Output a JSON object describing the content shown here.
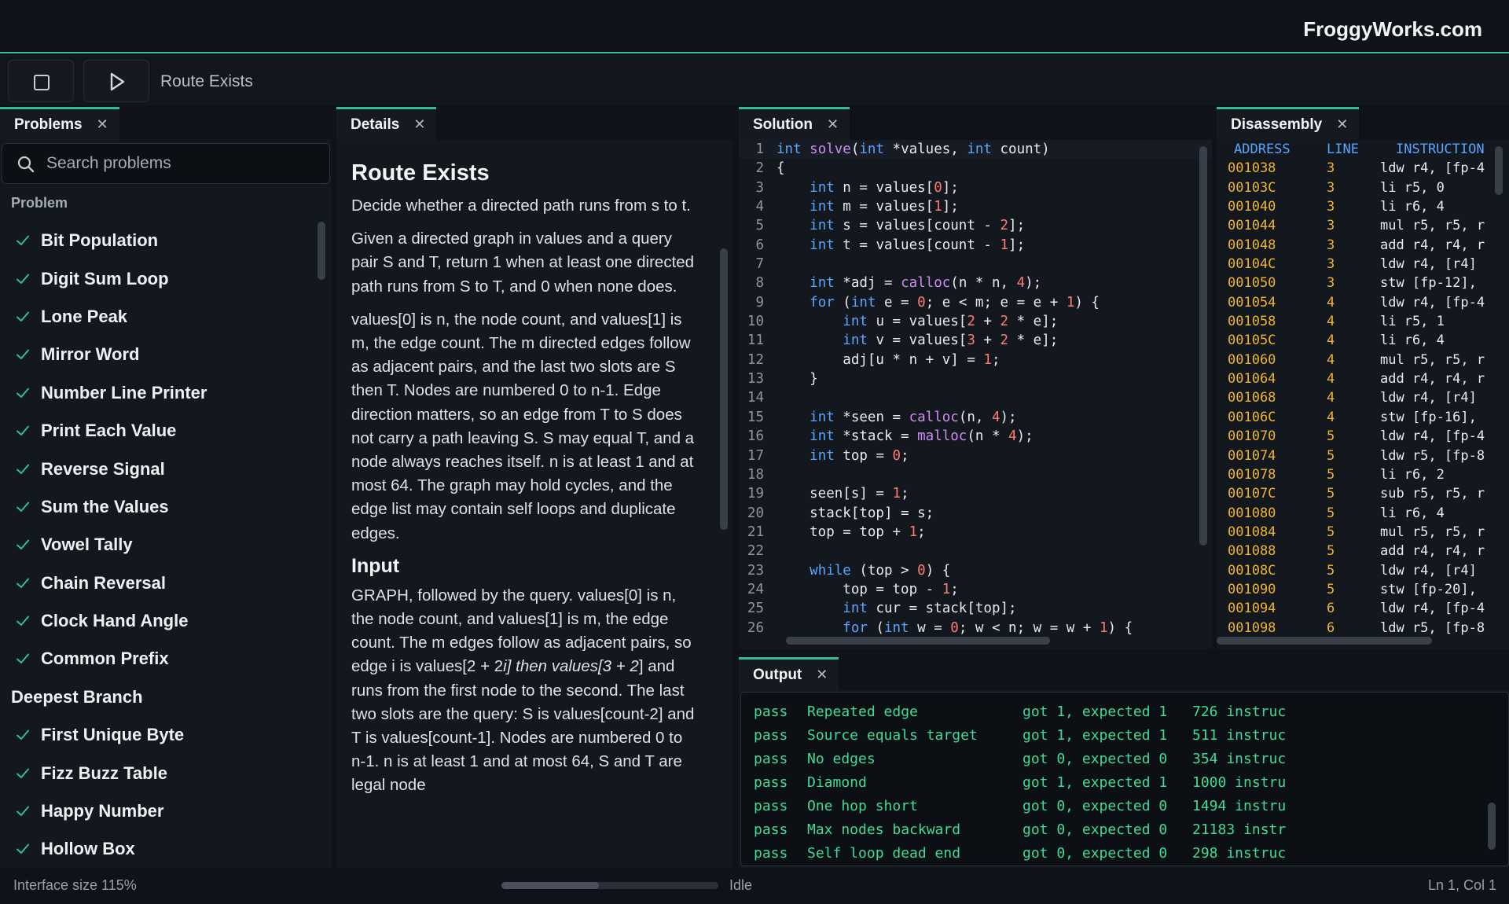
{
  "brand": "FroggyWorks.com",
  "toolbar": {
    "title": "Route Exists"
  },
  "problems": {
    "tab_label": "Problems",
    "search_placeholder": "Search problems",
    "header": "Problem",
    "items": [
      {
        "name": "Bit Population",
        "solved": true
      },
      {
        "name": "Digit Sum Loop",
        "solved": true
      },
      {
        "name": "Lone Peak",
        "solved": true
      },
      {
        "name": "Mirror Word",
        "solved": true
      },
      {
        "name": "Number Line Printer",
        "solved": true
      },
      {
        "name": "Print Each Value",
        "solved": true
      },
      {
        "name": "Reverse Signal",
        "solved": true
      },
      {
        "name": "Sum the Values",
        "solved": true
      },
      {
        "name": "Vowel Tally",
        "solved": true
      },
      {
        "name": "Chain Reversal",
        "solved": true
      },
      {
        "name": "Clock Hand Angle",
        "solved": true
      },
      {
        "name": "Common Prefix",
        "solved": true
      },
      {
        "name": "Deepest Branch",
        "solved": false
      },
      {
        "name": "First Unique Byte",
        "solved": true
      },
      {
        "name": "Fizz Buzz Table",
        "solved": true
      },
      {
        "name": "Happy Number",
        "solved": true
      },
      {
        "name": "Hollow Box",
        "solved": true
      }
    ]
  },
  "details": {
    "tab_label": "Details",
    "title": "Route Exists",
    "paragraphs": [
      "Decide whether a directed path runs from s to t.",
      "Given a directed graph in values and a query pair S and T, return 1 when at least one directed path runs from S to T, and 0 when none does.",
      "values[0] is n, the node count, and values[1] is m, the edge count. The m directed edges follow as adjacent pairs, and the last two slots are S then T. Nodes are numbered 0 to n-1. Edge direction matters, so an edge from T to S does not carry a path leaving S. S may equal T, and a node always reaches itself. n is at least 1 and at most 64. The graph may hold cycles, and the edge list may contain self loops and duplicate edges."
    ],
    "input_heading": "Input",
    "input_paragraph_a": "GRAPH, followed by the query. values[0] is n, the node count, and values[1] is m, the edge count. The m edges follow as adjacent pairs, so edge i is values[2 + 2",
    "input_paragraph_italic": "i] then values[3 + 2",
    "input_paragraph_b": "] and runs from the first node to the second. The last two slots are the query: S is values[count-2] and T is values[count-1]. Nodes are numbered 0 to n-1. n is at least 1 and at most 64, S and T are legal node"
  },
  "solution": {
    "tab_label": "Solution",
    "lines": [
      {
        "n": "1",
        "segs": [
          [
            "kw",
            "int"
          ],
          [
            "t",
            " "
          ],
          [
            "fn",
            "solve"
          ],
          [
            "t",
            "("
          ],
          [
            "kw",
            "int"
          ],
          [
            "t",
            " *values, "
          ],
          [
            "kw",
            "int"
          ],
          [
            "t",
            " count)"
          ]
        ]
      },
      {
        "n": "2",
        "segs": [
          [
            "t",
            "{"
          ]
        ]
      },
      {
        "n": "3",
        "segs": [
          [
            "t",
            "    "
          ],
          [
            "kw",
            "int"
          ],
          [
            "t",
            " n = values["
          ],
          [
            "nu",
            "0"
          ],
          [
            "t",
            "];"
          ]
        ]
      },
      {
        "n": "4",
        "segs": [
          [
            "t",
            "    "
          ],
          [
            "kw",
            "int"
          ],
          [
            "t",
            " m = values["
          ],
          [
            "nu",
            "1"
          ],
          [
            "t",
            "];"
          ]
        ]
      },
      {
        "n": "5",
        "segs": [
          [
            "t",
            "    "
          ],
          [
            "kw",
            "int"
          ],
          [
            "t",
            " s = values[count - "
          ],
          [
            "nu",
            "2"
          ],
          [
            "t",
            "];"
          ]
        ]
      },
      {
        "n": "6",
        "segs": [
          [
            "t",
            "    "
          ],
          [
            "kw",
            "int"
          ],
          [
            "t",
            " t = values[count - "
          ],
          [
            "nu",
            "1"
          ],
          [
            "t",
            "];"
          ]
        ]
      },
      {
        "n": "7",
        "segs": [
          [
            "t",
            ""
          ]
        ]
      },
      {
        "n": "8",
        "segs": [
          [
            "t",
            "    "
          ],
          [
            "kw",
            "int"
          ],
          [
            "t",
            " *adj = "
          ],
          [
            "fn",
            "calloc"
          ],
          [
            "t",
            "(n * n, "
          ],
          [
            "nu",
            "4"
          ],
          [
            "t",
            ");"
          ]
        ]
      },
      {
        "n": "9",
        "segs": [
          [
            "t",
            "    "
          ],
          [
            "kw",
            "for"
          ],
          [
            "t",
            " ("
          ],
          [
            "kw",
            "int"
          ],
          [
            "t",
            " e = "
          ],
          [
            "nu",
            "0"
          ],
          [
            "t",
            "; e < m; e = e + "
          ],
          [
            "nu",
            "1"
          ],
          [
            "t",
            ") {"
          ]
        ]
      },
      {
        "n": "10",
        "segs": [
          [
            "t",
            "        "
          ],
          [
            "kw",
            "int"
          ],
          [
            "t",
            " u = values["
          ],
          [
            "nu",
            "2"
          ],
          [
            "t",
            " + "
          ],
          [
            "nu",
            "2"
          ],
          [
            "t",
            " * e];"
          ]
        ]
      },
      {
        "n": "11",
        "segs": [
          [
            "t",
            "        "
          ],
          [
            "kw",
            "int"
          ],
          [
            "t",
            " v = values["
          ],
          [
            "nu",
            "3"
          ],
          [
            "t",
            " + "
          ],
          [
            "nu",
            "2"
          ],
          [
            "t",
            " * e];"
          ]
        ]
      },
      {
        "n": "12",
        "segs": [
          [
            "t",
            "        adj[u * n + v] = "
          ],
          [
            "nu",
            "1"
          ],
          [
            "t",
            ";"
          ]
        ]
      },
      {
        "n": "13",
        "segs": [
          [
            "t",
            "    }"
          ]
        ]
      },
      {
        "n": "14",
        "segs": [
          [
            "t",
            ""
          ]
        ]
      },
      {
        "n": "15",
        "segs": [
          [
            "t",
            "    "
          ],
          [
            "kw",
            "int"
          ],
          [
            "t",
            " *seen = "
          ],
          [
            "fn",
            "calloc"
          ],
          [
            "t",
            "(n, "
          ],
          [
            "nu",
            "4"
          ],
          [
            "t",
            ");"
          ]
        ]
      },
      {
        "n": "16",
        "segs": [
          [
            "t",
            "    "
          ],
          [
            "kw",
            "int"
          ],
          [
            "t",
            " *stack = "
          ],
          [
            "fn",
            "malloc"
          ],
          [
            "t",
            "(n * "
          ],
          [
            "nu",
            "4"
          ],
          [
            "t",
            ");"
          ]
        ]
      },
      {
        "n": "17",
        "segs": [
          [
            "t",
            "    "
          ],
          [
            "kw",
            "int"
          ],
          [
            "t",
            " top = "
          ],
          [
            "nu",
            "0"
          ],
          [
            "t",
            ";"
          ]
        ]
      },
      {
        "n": "18",
        "segs": [
          [
            "t",
            ""
          ]
        ]
      },
      {
        "n": "19",
        "segs": [
          [
            "t",
            "    seen[s] = "
          ],
          [
            "nu",
            "1"
          ],
          [
            "t",
            ";"
          ]
        ]
      },
      {
        "n": "20",
        "segs": [
          [
            "t",
            "    stack[top] = s;"
          ]
        ]
      },
      {
        "n": "21",
        "segs": [
          [
            "t",
            "    top = top + "
          ],
          [
            "nu",
            "1"
          ],
          [
            "t",
            ";"
          ]
        ]
      },
      {
        "n": "22",
        "segs": [
          [
            "t",
            ""
          ]
        ]
      },
      {
        "n": "23",
        "segs": [
          [
            "t",
            "    "
          ],
          [
            "kw",
            "while"
          ],
          [
            "t",
            " (top > "
          ],
          [
            "nu",
            "0"
          ],
          [
            "t",
            ") {"
          ]
        ]
      },
      {
        "n": "24",
        "segs": [
          [
            "t",
            "        top = top - "
          ],
          [
            "nu",
            "1"
          ],
          [
            "t",
            ";"
          ]
        ]
      },
      {
        "n": "25",
        "segs": [
          [
            "t",
            "        "
          ],
          [
            "kw",
            "int"
          ],
          [
            "t",
            " cur = stack[top];"
          ]
        ]
      },
      {
        "n": "26",
        "segs": [
          [
            "t",
            "        "
          ],
          [
            "kw",
            "for"
          ],
          [
            "t",
            " ("
          ],
          [
            "kw",
            "int"
          ],
          [
            "t",
            " w = "
          ],
          [
            "nu",
            "0"
          ],
          [
            "t",
            "; w < n; w = w + "
          ],
          [
            "nu",
            "1"
          ],
          [
            "t",
            ") {"
          ]
        ]
      }
    ]
  },
  "disassembly": {
    "tab_label": "Disassembly",
    "headers": {
      "address": "ADDRESS",
      "line": "LINE",
      "instruction": "INSTRUCTION"
    },
    "rows": [
      {
        "a": "001038",
        "l": "3",
        "i": "ldw r4, [fp-4"
      },
      {
        "a": "00103C",
        "l": "3",
        "i": "li r5, 0"
      },
      {
        "a": "001040",
        "l": "3",
        "i": "li r6, 4"
      },
      {
        "a": "001044",
        "l": "3",
        "i": "mul r5, r5, r"
      },
      {
        "a": "001048",
        "l": "3",
        "i": "add r4, r4, r"
      },
      {
        "a": "00104C",
        "l": "3",
        "i": "ldw r4, [r4]"
      },
      {
        "a": "001050",
        "l": "3",
        "i": "stw [fp-12],"
      },
      {
        "a": "001054",
        "l": "4",
        "i": "ldw r4, [fp-4"
      },
      {
        "a": "001058",
        "l": "4",
        "i": "li r5, 1"
      },
      {
        "a": "00105C",
        "l": "4",
        "i": "li r6, 4"
      },
      {
        "a": "001060",
        "l": "4",
        "i": "mul r5, r5, r"
      },
      {
        "a": "001064",
        "l": "4",
        "i": "add r4, r4, r"
      },
      {
        "a": "001068",
        "l": "4",
        "i": "ldw r4, [r4]"
      },
      {
        "a": "00106C",
        "l": "4",
        "i": "stw [fp-16],"
      },
      {
        "a": "001070",
        "l": "5",
        "i": "ldw r4, [fp-4"
      },
      {
        "a": "001074",
        "l": "5",
        "i": "ldw r5, [fp-8"
      },
      {
        "a": "001078",
        "l": "5",
        "i": "li r6, 2"
      },
      {
        "a": "00107C",
        "l": "5",
        "i": "sub r5, r5, r"
      },
      {
        "a": "001080",
        "l": "5",
        "i": "li r6, 4"
      },
      {
        "a": "001084",
        "l": "5",
        "i": "mul r5, r5, r"
      },
      {
        "a": "001088",
        "l": "5",
        "i": "add r4, r4, r"
      },
      {
        "a": "00108C",
        "l": "5",
        "i": "ldw r4, [r4]"
      },
      {
        "a": "001090",
        "l": "5",
        "i": "stw [fp-20],"
      },
      {
        "a": "001094",
        "l": "6",
        "i": "ldw r4, [fp-4"
      },
      {
        "a": "001098",
        "l": "6",
        "i": "ldw r5, [fp-8"
      }
    ]
  },
  "output": {
    "tab_label": "Output",
    "rows": [
      {
        "status": "pass",
        "name": "Repeated edge",
        "got": "got 1, expected 1",
        "instr": "726 instruc"
      },
      {
        "status": "pass",
        "name": "Source equals target",
        "got": "got 1, expected 1",
        "instr": "511 instruc"
      },
      {
        "status": "pass",
        "name": "No edges",
        "got": "got 0, expected 0",
        "instr": "354 instruc"
      },
      {
        "status": "pass",
        "name": "Diamond",
        "got": "got 1, expected 1",
        "instr": "1000 instru"
      },
      {
        "status": "pass",
        "name": "One hop short",
        "got": "got 0, expected 0",
        "instr": "1494 instru"
      },
      {
        "status": "pass",
        "name": "Max nodes backward",
        "got": "got 0, expected 0",
        "instr": "21183 instr"
      },
      {
        "status": "pass",
        "name": "Self loop dead end",
        "got": "got 0, expected 0",
        "instr": "298 instruc"
      }
    ]
  },
  "status": {
    "zoom": "Interface size 115%",
    "state": "Idle",
    "position": "Ln 1, Col 1",
    "progress": 0.45
  },
  "colors": {
    "accent": "#2fbf8f",
    "pass": "#3ddc97",
    "keyword": "#58a6ff",
    "function": "#d18cf2",
    "number": "#ff7b72",
    "address": "#f0b429"
  }
}
